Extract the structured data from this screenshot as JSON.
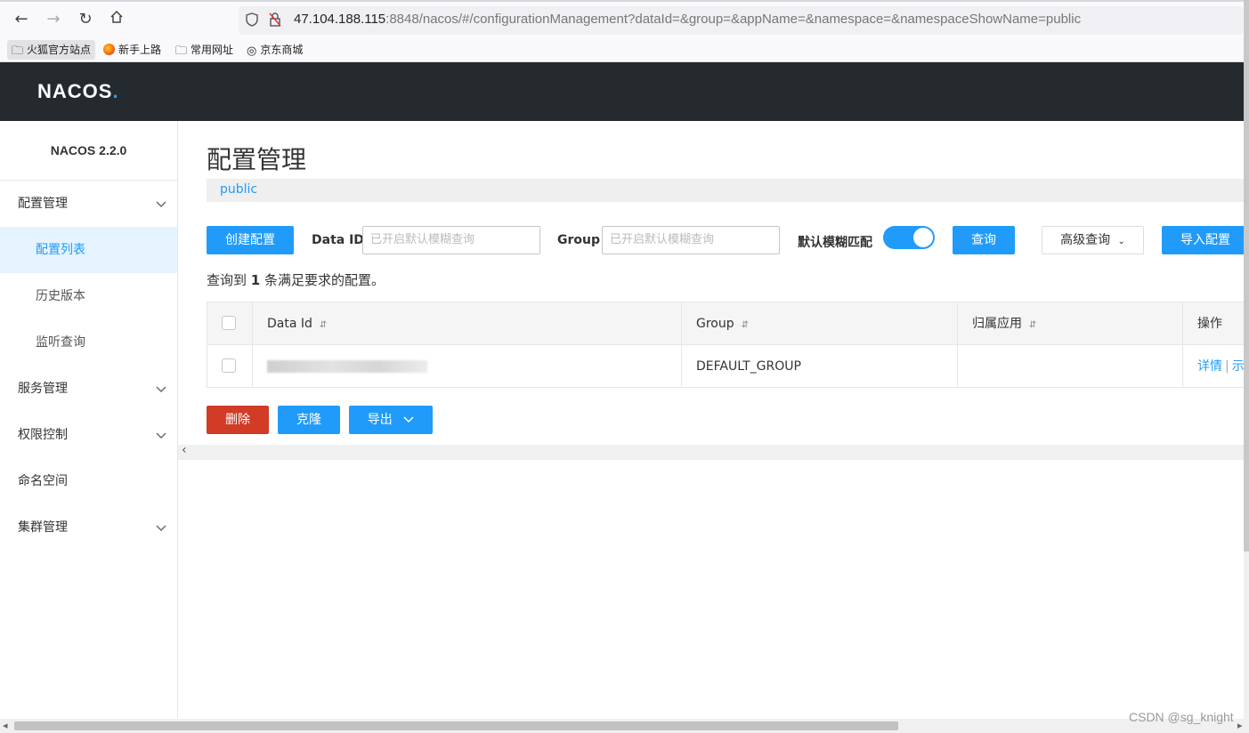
{
  "browser": {
    "url_host": "47.104.188.115",
    "url_rest": ":8848/nacos/#/configurationManagement?dataId=&group=&appName=&namespace=&namespaceShowName=public",
    "bookmarks": [
      "火狐官方站点",
      "新手上路",
      "常用网址",
      "京东商城"
    ]
  },
  "header": {
    "logo_main": "NACOS",
    "logo_dot": "."
  },
  "sidebar": {
    "version": "NACOS 2.2.0",
    "items": [
      {
        "label": "配置管理",
        "type": "group"
      },
      {
        "label": "配置列表",
        "type": "sub",
        "active": true
      },
      {
        "label": "历史版本",
        "type": "sub"
      },
      {
        "label": "监听查询",
        "type": "sub"
      },
      {
        "label": "服务管理",
        "type": "group"
      },
      {
        "label": "权限控制",
        "type": "group"
      },
      {
        "label": "命名空间",
        "type": "item"
      },
      {
        "label": "集群管理",
        "type": "group"
      }
    ]
  },
  "main": {
    "title": "配置管理",
    "namespace": "public",
    "create_button": "创建配置",
    "data_id_label": "Data ID",
    "data_id_placeholder": "已开启默认模糊查询",
    "group_label": "Group",
    "group_placeholder": "已开启默认模糊查询",
    "fuzzy_label": "默认模糊匹配",
    "fuzzy_enabled": true,
    "query_button": "查询",
    "advanced_button": "高级查询",
    "import_button": "导入配置",
    "result_prefix": "查询到",
    "result_count": "1",
    "result_suffix": "条满足要求的配置。",
    "table": {
      "columns": [
        "Data Id",
        "Group",
        "归属应用",
        "操作"
      ],
      "rows": [
        {
          "data_id": "kingcloud-schedule-prod.yaml",
          "group": "DEFAULT_GROUP",
          "app": "",
          "actions": [
            "详情",
            "示"
          ]
        }
      ]
    },
    "delete_button": "删除",
    "clone_button": "克隆",
    "export_button": "导出"
  },
  "watermark": "CSDN @sg_knight"
}
